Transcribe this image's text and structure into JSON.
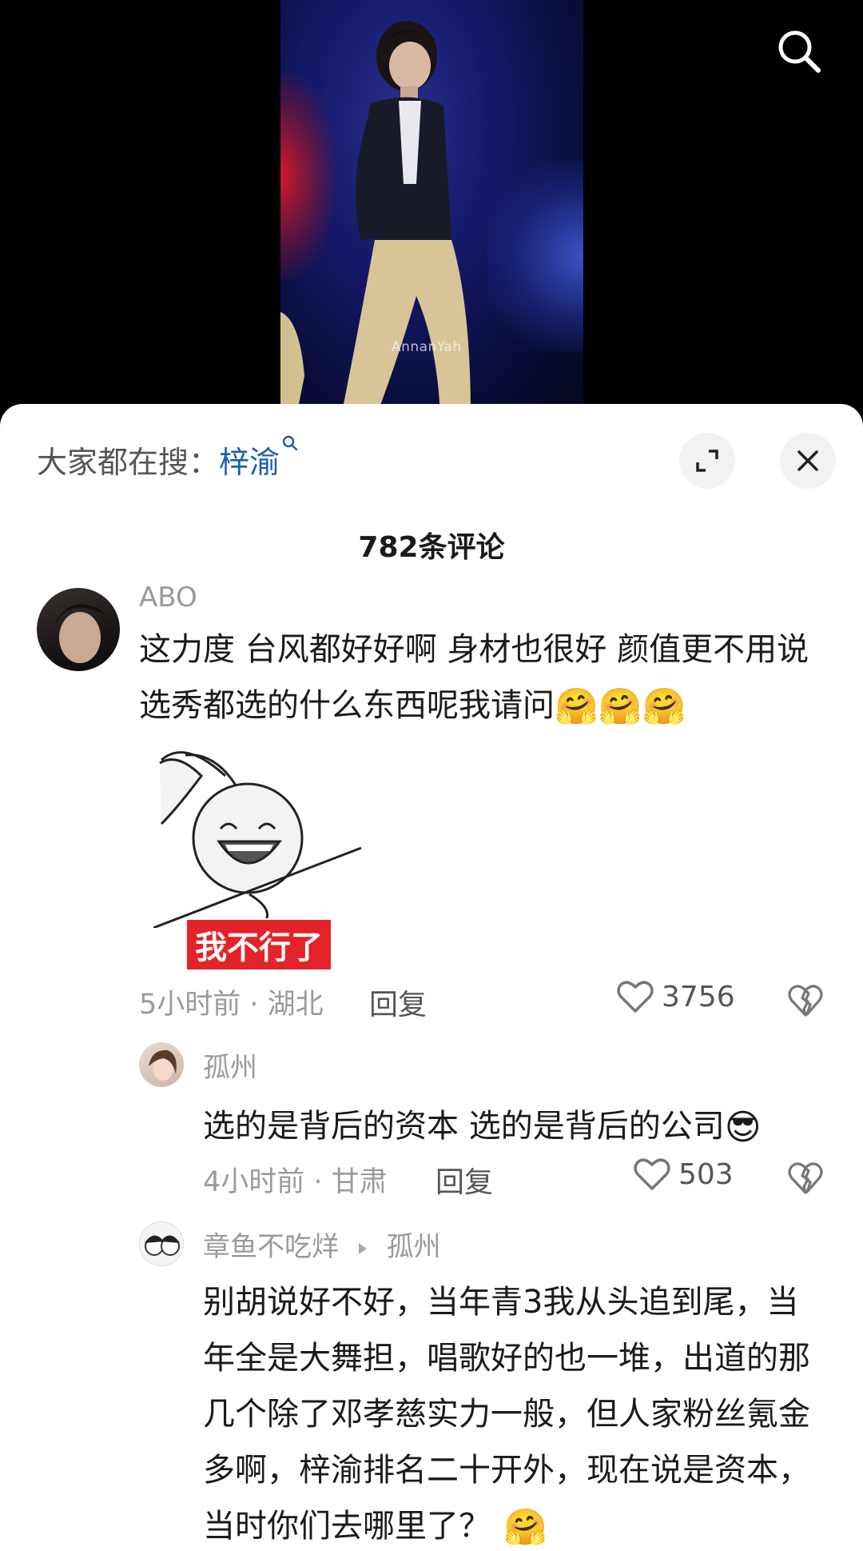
{
  "video": {
    "watermark": "AnnanYah"
  },
  "sheet": {
    "hot_search_prefix": "大家都在搜：",
    "hot_search_keyword": "梓渝",
    "comment_count": "782条评论"
  },
  "comments": [
    {
      "username": "ABO",
      "text": "这力度 台风都好好啊 身材也很好 颜值更不用说 选秀都选的什么东西呢我请问",
      "emojis": [
        "🤗",
        "🤗",
        "🤗"
      ],
      "sticker_text": "我不行了",
      "time_location": "5小时前 · 湖北",
      "reply_label": "回复",
      "likes": "3756"
    },
    {
      "username": "孤州",
      "text": "选的是背后的资本 选的是背后的公司",
      "emoji": "😎",
      "time_location": "4小时前 · 甘肃",
      "reply_label": "回复",
      "likes": "503"
    },
    {
      "username": "章鱼不吃烊",
      "reply_to": "孤州",
      "text": "别胡说好不好，当年青3我从头追到尾，当年全是大舞担，唱歌好的也一堆，出道的那几个除了邓孝慈实力一般，但人家粉丝氪金多啊，梓渝排名二十开外，现在说是资本，当时你们去哪里了？",
      "emoji": "🤗"
    }
  ],
  "icons": {
    "search": "search-icon",
    "expand": "expand-icon",
    "close": "close-icon",
    "like": "heart-icon",
    "dislike": "broken-heart-icon"
  },
  "colors": {
    "keyword": "#1f5fa8",
    "sticker_label_bg": "#e3232a"
  }
}
